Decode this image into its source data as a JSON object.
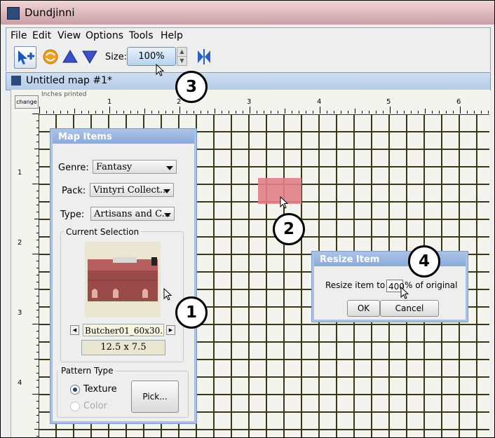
{
  "window": {
    "title": "Dundjinni"
  },
  "menu": [
    "File",
    "Edit",
    "View",
    "Options",
    "Tools",
    "Help"
  ],
  "toolbar": {
    "size_label": "Size:",
    "size_value": "100%"
  },
  "document": {
    "tab_title": "Untitled map #1*"
  },
  "ruler": {
    "change_label": "change",
    "units_label": "Inches printed",
    "top_numbers": [
      "1",
      "2",
      "3",
      "4",
      "5",
      "6"
    ],
    "left_numbers": [
      "1",
      "2",
      "3",
      "4"
    ]
  },
  "map_items": {
    "title": "Map Items",
    "genre_label": "Genre:",
    "genre_value": "Fantasy",
    "pack_label": "Pack:",
    "pack_value": "Vintyri Collect...",
    "type_label": "Type:",
    "type_value": "Artisans and C...",
    "current_selection_label": "Current Selection",
    "item_name": "Butcher01_60x30...",
    "item_dimensions": "12.5 x 7.5",
    "pattern_type_label": "Pattern Type",
    "texture_label": "Texture",
    "color_label": "Color",
    "pick_label": "Pick..."
  },
  "resize_dialog": {
    "title": "Resize Item",
    "prompt_before": "Resize item to",
    "value": "400",
    "prompt_after": "% of original",
    "ok_label": "OK",
    "cancel_label": "Cancel"
  },
  "callouts": [
    "1",
    "2",
    "3",
    "4"
  ],
  "colors": {
    "title_bar": "#e2bfc3",
    "panel_border": "#a9c2e4",
    "grid_line": "#3a3618",
    "map_background": "#f4f4ee",
    "item_fill": "#e07f86"
  }
}
